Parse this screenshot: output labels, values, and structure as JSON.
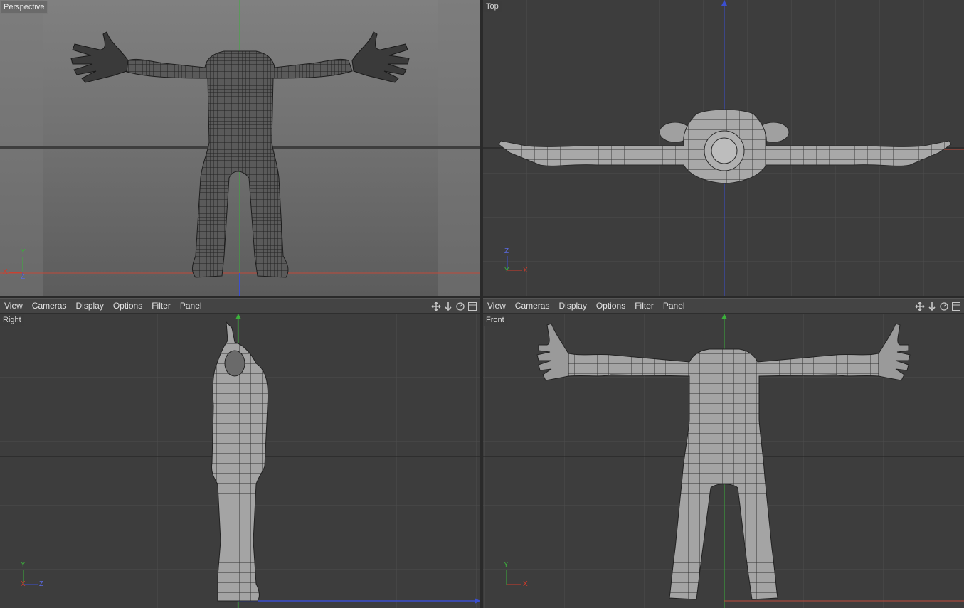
{
  "viewports": {
    "perspective": {
      "label": "Perspective",
      "axis": {
        "y": "Y",
        "x": "X",
        "z": "Z"
      }
    },
    "top": {
      "label": "Top",
      "axis": {
        "z": "Z",
        "y": "Y",
        "x": "X"
      }
    },
    "right": {
      "label": "Right",
      "axis": {
        "y": "Y",
        "x": "X",
        "z": "Z"
      }
    },
    "front": {
      "label": "Front",
      "axis": {
        "y": "Y",
        "x": "X"
      }
    }
  },
  "menubar": {
    "left": {
      "view": "View",
      "cameras": "Cameras",
      "display": "Display",
      "options": "Options",
      "filter": "Filter",
      "panel": "Panel"
    },
    "right": {
      "view": "View",
      "cameras": "Cameras",
      "display": "Display",
      "options": "Options",
      "filter": "Filter",
      "panel": "Panel"
    }
  },
  "icons": [
    "move-view-icon",
    "dolly-icon",
    "rotate-view-icon",
    "maximize-panel-icon"
  ],
  "colors": {
    "x_axis": "#d03a2a",
    "y_axis": "#3bb03b",
    "z_axis": "#3b4fd0",
    "grid": "#4a4a4a",
    "mesh_fill": "#9c9c9c",
    "mesh_wire": "#2a2a2a"
  }
}
